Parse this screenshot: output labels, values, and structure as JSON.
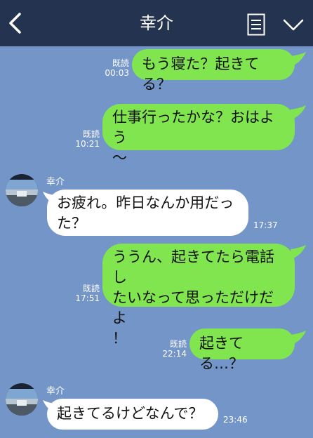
{
  "header": {
    "title": "幸介",
    "back_icon": "chevron-left-icon",
    "menu_icon": "list-icon",
    "expand_icon": "chevron-down-icon"
  },
  "colors": {
    "header_bg": "#243450",
    "chat_bg": "#7495c8",
    "outgoing_bubble": "#80e54e",
    "incoming_bubble": "#ffffff"
  },
  "messages": [
    {
      "direction": "out",
      "text": "もう寝た？起きてる？",
      "read_label": "既読",
      "time": "00:03"
    },
    {
      "direction": "out",
      "text_line1": "仕事行ったかな？おはよう",
      "text_line2": "〜",
      "read_label": "既読",
      "time": "10:21"
    },
    {
      "direction": "in",
      "sender": "幸介",
      "text_line1": "お疲れ。昨日なんか用だっ",
      "text_line2": "た？",
      "time": "17:37"
    },
    {
      "direction": "out",
      "text_line1": "ううん、起きてたら電話し",
      "text_line2": "たいなって思っただけだよ",
      "text_line3": "！",
      "read_label": "既読",
      "time": "17:51"
    },
    {
      "direction": "out",
      "text": "起きてる…？",
      "read_label": "既読",
      "time": "22:14"
    },
    {
      "direction": "in",
      "sender": "幸介",
      "text": "起きてるけどなんで？",
      "time": "23:46"
    }
  ]
}
